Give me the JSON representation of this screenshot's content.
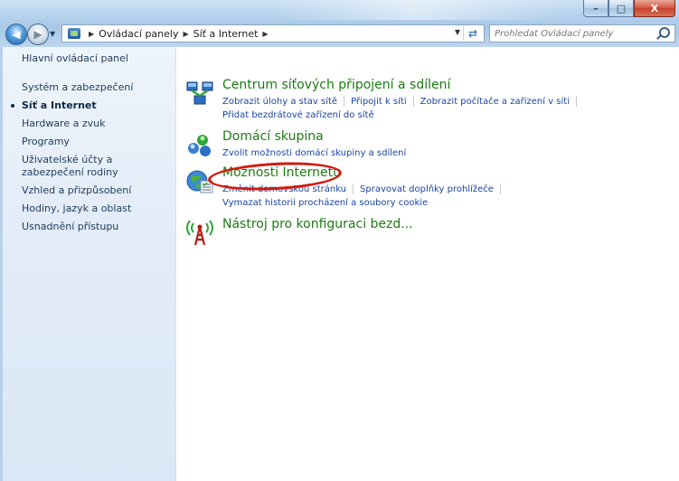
{
  "window": {
    "controls": {
      "minimize": "–",
      "maximize": "□",
      "close": "X"
    }
  },
  "nav": {
    "back_icon": "back-arrow-icon",
    "forward_icon": "forward-arrow-icon",
    "breadcrumbs": [
      "Ovládací panely",
      "Síť a Internet"
    ],
    "search_placeholder": "Prohledat Ovládací panely"
  },
  "sidebar": {
    "home": "Hlavní ovládací panel",
    "items": [
      {
        "label": "Systém a zabezpečení",
        "active": false
      },
      {
        "label": "Síť a Internet",
        "active": true
      },
      {
        "label": "Hardware a zvuk",
        "active": false
      },
      {
        "label": "Programy",
        "active": false
      },
      {
        "label": "Uživatelské účty a zabezpečení rodiny",
        "active": false
      },
      {
        "label": "Vzhled a přizpůsobení",
        "active": false
      },
      {
        "label": "Hodiny, jazyk a oblast",
        "active": false
      },
      {
        "label": "Usnadnění přístupu",
        "active": false
      }
    ]
  },
  "categories": [
    {
      "title": "Centrum síťových připojení a sdílení",
      "icon": "network-center-icon",
      "links": [
        "Zobrazit úlohy a stav sítě",
        "Připojit k síti",
        "Zobrazit počítače a zařízení v síti",
        "Přidat bezdrátové zařízení do sítě"
      ]
    },
    {
      "title": "Domácí skupina",
      "icon": "homegroup-icon",
      "links": [
        "Zvolit možnosti domácí skupiny a sdílení"
      ]
    },
    {
      "title": "Možnosti Internetu",
      "icon": "internet-options-icon",
      "links": [
        "Změnit domovskou stránku",
        "Spravovat doplňky prohlížeče",
        "Vymazat historii procházení a soubory cookie"
      ]
    },
    {
      "title": "Nástroj pro konfiguraci bezd...",
      "icon": "wireless-config-icon",
      "links": []
    }
  ],
  "colors": {
    "link_green": "#1e7a14",
    "link_blue": "#1a45a4",
    "highlight_red": "#d11a0f"
  }
}
